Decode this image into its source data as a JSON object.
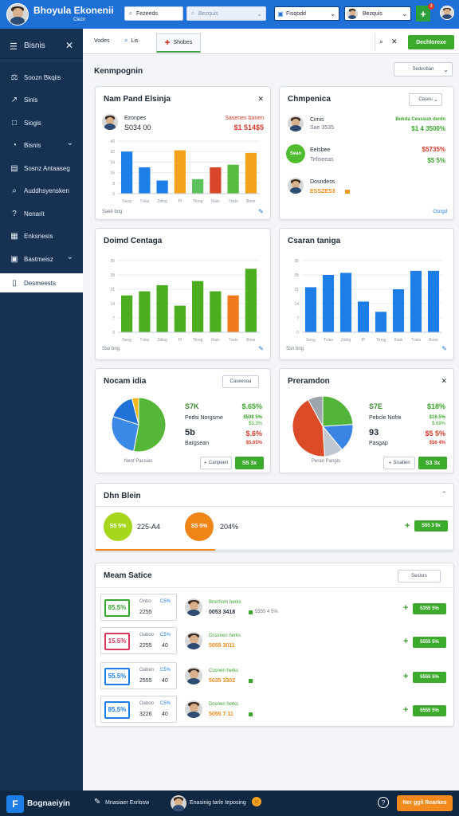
{
  "app": {
    "title": "Bhoyula Ekonenii",
    "subtitle": "Clezn",
    "logo_icon": "avatar-icon",
    "search_1": "Fezeeds",
    "search_2": "Bezquis",
    "dropdown_1": "Fisqodd",
    "user_name": "Bezquis",
    "notifications_count": "3"
  },
  "sidebar": {
    "title": "Bisnis",
    "items": [
      {
        "icon": "scale-icon",
        "label": "Soozn Bkqiis"
      },
      {
        "icon": "trend-icon",
        "label": "Sinis"
      },
      {
        "icon": "square-icon",
        "label": "Siogis"
      },
      {
        "icon": "chart-icon",
        "label": "Bisnis"
      },
      {
        "icon": "table-icon",
        "label": "Sosnz Antaaseg"
      },
      {
        "icon": "search-icon",
        "label": "Auddhsyensken"
      },
      {
        "icon": "question-icon",
        "label": "Nenarit"
      },
      {
        "icon": "clipboard-icon",
        "label": "Enksnesis"
      },
      {
        "icon": "briefcase-icon",
        "label": "Bastmeisz"
      },
      {
        "icon": "file-icon",
        "label": "Desmeests"
      }
    ]
  },
  "toolbar": {
    "tab_1": "Vodes",
    "tab_2": "Lis",
    "tab_3": "Shobes",
    "search_icon": "search-icon",
    "close_icon": "close-icon",
    "primary_button": "Dechlorexe"
  },
  "main": {
    "page_title": "Kenmpognin",
    "page_select": "Sedvoban"
  },
  "cards": {
    "card1": {
      "title": "Nam Pand Elsinja",
      "meta_left": "Ezonpes",
      "value_left": "S034 00",
      "meta_right": "Sasenes banen",
      "value_right": "$1 514$5",
      "footer": "Saeti brig",
      "chart_data": {
        "type": "bar",
        "categories": [
          "Seog",
          "Tvias",
          "Zding",
          "Pi",
          "Ttnsg",
          "Ihais",
          "Tnsis",
          "Bose"
        ],
        "values": [
          32,
          20,
          10,
          33,
          11,
          20,
          22,
          31
        ],
        "colors": [
          "#1e7ee8",
          "#1e7ee8",
          "#1e7ee8",
          "#f3a31b",
          "#5cc05b",
          "#d9472b",
          "#58bd3e",
          "#f3a31b"
        ],
        "ylim": [
          0,
          40
        ],
        "ticks": [
          "",
          "",
          "",
          "",
          "",
          ""
        ],
        "grid": true
      }
    },
    "card2": {
      "title": "Chmpenica",
      "select": "Caseu",
      "person1_name": "Cimis",
      "person1_sub": "Sae 3535",
      "person1_value": "Bnkda Cesssun denln",
      "person1_value2": "$1 4 3500%",
      "person2_badge": "Sean",
      "person2_name": "Eelsbee",
      "person2_sub": "Tefiseeas",
      "person2_value": "$5735%",
      "person2_value2": "$5 5%",
      "person3_name": "Dosndess",
      "person3_sub": "ESSZES3",
      "footer": "Osngd"
    },
    "card3": {
      "title": "Doimd Centaga",
      "footer": "Sse brig",
      "chart_data": {
        "type": "bar",
        "categories": [
          "Seog",
          "Tvias",
          "Zding",
          "Pi",
          "Ttnsg",
          "Ihais",
          "Tnsis",
          "Bose"
        ],
        "values": [
          18,
          20,
          23,
          13,
          25,
          20,
          18,
          31
        ],
        "colors": [
          "#4bad1f",
          "#4bad1f",
          "#4bad1f",
          "#4bad1f",
          "#4bad1f",
          "#4bad1f",
          "#ee7a1c",
          "#4bad1f"
        ],
        "ylim": [
          0,
          35
        ],
        "grid": true
      }
    },
    "card4": {
      "title": "Csaran taniga",
      "footer": "Ssn brig",
      "chart_data": {
        "type": "bar",
        "categories": [
          "Seog",
          "Tvias",
          "Zding",
          "Pi",
          "Ttnsg",
          "Ihais",
          "Tnsis",
          "Bose"
        ],
        "values": [
          22,
          28,
          29,
          15,
          10,
          21,
          30,
          30
        ],
        "colors": [
          "#1e7ee8",
          "#1e7ee8",
          "#1e7ee8",
          "#1e7ee8",
          "#1e7ee8",
          "#1e7ee8",
          "#1e7ee8",
          "#1e7ee8"
        ],
        "ylim": [
          0,
          35
        ],
        "grid": true
      }
    },
    "card5": {
      "title": "Nocam idia",
      "select": "Caseesoa",
      "a_label": "S7K",
      "a_value": "$.65%",
      "b_label": "Pedsi Norgsme",
      "b_value": "$508 5%",
      "c_label": "5b",
      "c_value": "$.6%",
      "d_value": "$3.3%",
      "e_label": "Bargsean",
      "e_value": "$5.65%",
      "footer": "Nenf Pacsias",
      "btn1": "Canpeen",
      "btn2": "S5 3x",
      "chart_data": {
        "type": "pie",
        "slices": [
          {
            "label": "A",
            "value": 53,
            "color": "#55b637"
          },
          {
            "label": "B",
            "value": 27,
            "color": "#3b89e6"
          },
          {
            "label": "C",
            "value": 16,
            "color": "#1e72d8"
          },
          {
            "label": "D",
            "value": 4,
            "color": "#f2b71d"
          }
        ]
      }
    },
    "card6": {
      "title": "Preramdon",
      "a_label": "S7E",
      "a_value": "$18%",
      "b_label": "Pebcle Nofre",
      "b_value": "$16.5%",
      "c_label": "93",
      "c_value": "$5 5%",
      "d_value": "$.69%",
      "e_label": "Pasgap",
      "e_value": "$56 4%",
      "footer": "Peran Pangis",
      "btn1": "Sisatien",
      "btn2": "S3 3x",
      "chart_data": {
        "type": "pie",
        "slices": [
          {
            "label": "A",
            "value": 24,
            "color": "#53b43b"
          },
          {
            "label": "B",
            "value": 15,
            "color": "#3a85e3"
          },
          {
            "label": "C",
            "value": 10,
            "color": "#c0c7d1"
          },
          {
            "label": "D",
            "value": 43,
            "color": "#dc4b27"
          },
          {
            "label": "E",
            "value": 8,
            "color": "#9ea5ad"
          }
        ]
      }
    },
    "card7": {
      "title": "Dhn Blein",
      "left_badge": "S5 5%",
      "left_value": "225-A4",
      "right_badge": "S5 5%",
      "right_value": "204%",
      "action": "S55 3 9x"
    },
    "card8": {
      "title": "Meam Satice",
      "select": "Seslsrs",
      "rows": [
        {
          "badge": "85.5%",
          "badge_color": "#38a530",
          "label_top": "Onbo",
          "label_mid": "2255",
          "link": "C5%",
          "person_title": "Bnerhom herks",
          "person_sub": "0053 3418",
          "bars": "5555 4 5%",
          "action": "5355 5%"
        },
        {
          "badge": "15.5%",
          "badge_color": "#d7365d",
          "label_top": "Oaboo",
          "label_mid": "2255",
          "link": "C5%",
          "value": "40",
          "person_title": "Osssnen herks",
          "person_sub": "5055 3011",
          "action": "5555 5%"
        },
        {
          "badge": "55.5%",
          "badge_color": "#1e7ee8",
          "label_top": "Oaben",
          "label_mid": "2555",
          "link": "C5%",
          "value": "40",
          "person_title": "Cosnen herks",
          "person_sub": "5035 3302",
          "action": "5555 5%"
        },
        {
          "badge": "85.5%",
          "badge_color": "#1e7ee8",
          "label_top": "Oaboo",
          "label_mid": "3226",
          "link": "C5%",
          "value": "40",
          "person_title": "Dosnen herks",
          "person_sub": "5055 7 11",
          "action": "5555 5%"
        }
      ]
    }
  },
  "bottom": {
    "brand": "Bognaeiyin",
    "item_1": "Mnasiaer Exrlosw",
    "item_2": "Enasinig tarle teposing",
    "help_icon": "question-icon",
    "cta": "Ner ggli Rearkes"
  }
}
